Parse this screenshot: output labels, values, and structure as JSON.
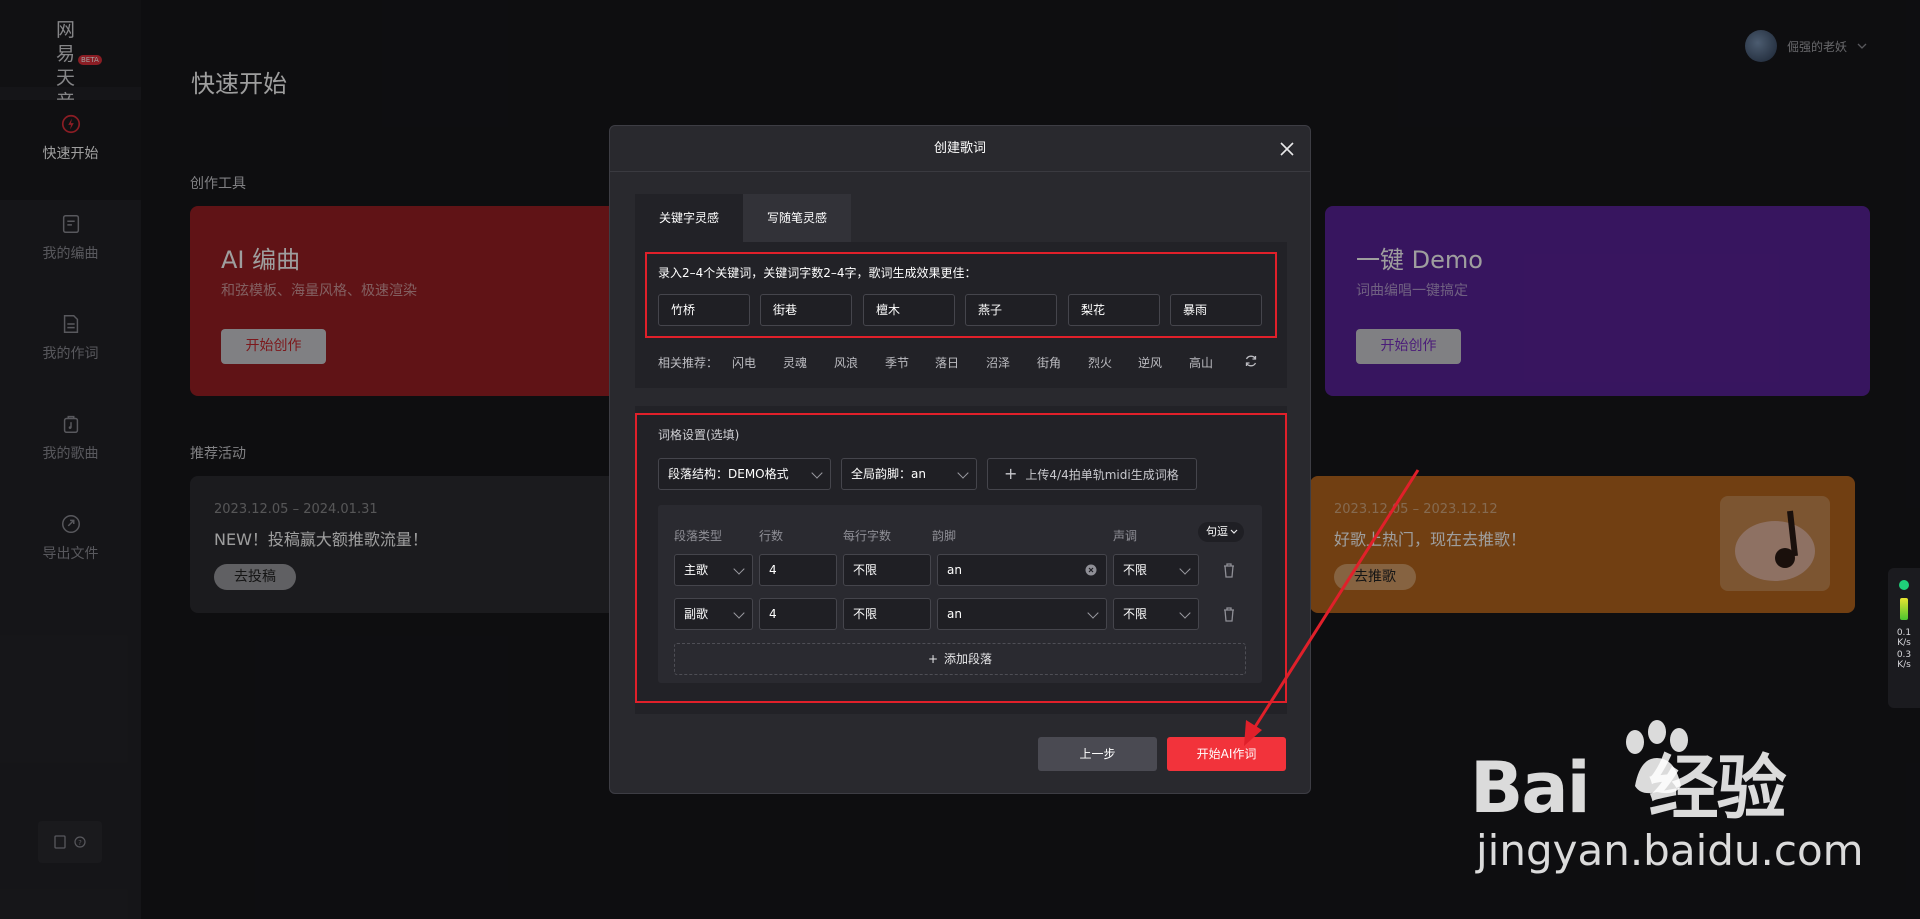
{
  "sidebar": {
    "logo_text": "网易天音",
    "logo_badge": "BETA",
    "items": [
      {
        "label": "快速开始",
        "icon": "lightning-icon"
      },
      {
        "label": "我的编曲",
        "icon": "score-icon"
      },
      {
        "label": "我的作词",
        "icon": "document-icon"
      },
      {
        "label": "我的歌曲",
        "icon": "music-bag-icon"
      },
      {
        "label": "导出文件",
        "icon": "export-icon"
      }
    ]
  },
  "user": {
    "name": "倔强的老妖"
  },
  "main": {
    "title": "快速开始",
    "tools_label": "创作工具",
    "tools": [
      {
        "title": "AI 编曲",
        "subtitle": "和弦模板、海量风格、极速渲染",
        "button": "开始创作",
        "color": "#9c1f24"
      },
      {
        "title": "一键 Demo",
        "subtitle": "词曲编唱一键搞定",
        "button": "开始创作",
        "color": "#5a2299"
      }
    ],
    "activities_label": "推荐活动",
    "activities": [
      {
        "date": "2023.12.05 – 2024.01.31",
        "title": "NEW！投稿赢大额推歌流量！",
        "button": "去投稿"
      },
      {
        "date": "2023.12.05 – 2023.12.12",
        "title": "好歌上热门，现在去推歌！",
        "button": "去推歌"
      }
    ]
  },
  "modal": {
    "title": "创建歌词",
    "tabs": [
      "关键字灵感",
      "写随笔灵感"
    ],
    "keyword_hint": "录入2–4个关键词，关键词字数2–4字，歌词生成效果更佳：",
    "keywords": [
      "竹桥",
      "街巷",
      "檀木",
      "燕子",
      "梨花",
      "暴雨"
    ],
    "recommend_label": "相关推荐：",
    "recommend": [
      "闪电",
      "灵魂",
      "风浪",
      "季节",
      "落日",
      "沼泽",
      "街角",
      "烈火",
      "逆风",
      "高山"
    ],
    "settings_title": "词格设置(选填)",
    "structure_select": "段落结构：DEMO格式",
    "rhyme_select": "全局韵脚：an",
    "upload_button": "上传4/4拍单轨midi生成词格",
    "table": {
      "headers": [
        "段落类型",
        "行数",
        "每行字数",
        "韵脚",
        "声调"
      ],
      "mode_select": "句逗",
      "rows": [
        {
          "type": "主歌",
          "lines": "4",
          "chars": "不限",
          "rhyme": "an",
          "tone": "不限"
        },
        {
          "type": "副歌",
          "lines": "4",
          "chars": "不限",
          "rhyme": "an",
          "tone": "不限"
        }
      ],
      "add_label": "添加段落"
    },
    "prev_button": "上一步",
    "start_button": "开始AI作词"
  },
  "floater": {
    "up": "0.1",
    "up_unit": "K/s",
    "down": "0.3",
    "down_unit": "K/s"
  },
  "watermark": {
    "brand": "Bai",
    "brand_suffix": "经验",
    "url": "jingyan.baidu.com"
  }
}
